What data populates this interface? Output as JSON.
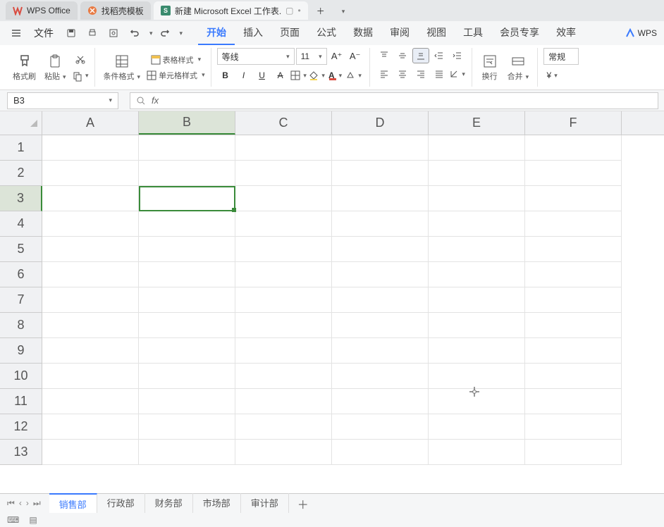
{
  "title_tabs": [
    {
      "icon": "wps",
      "label": "WPS Office"
    },
    {
      "icon": "template",
      "label": "找稻壳模板"
    },
    {
      "icon": "excel",
      "label": "新建 Microsoft Excel 工作表.",
      "active": true
    }
  ],
  "file_menu": "文件",
  "menu": {
    "items": [
      "开始",
      "插入",
      "页面",
      "公式",
      "数据",
      "审阅",
      "视图",
      "工具",
      "会员专享",
      "效率"
    ],
    "active": "开始",
    "ai": "WPS"
  },
  "ribbon": {
    "format_brush": "格式刷",
    "paste": "粘贴",
    "cond_format": "条件格式",
    "table_style": "表格样式",
    "cell_style": "单元格样式",
    "font_name": "等线",
    "font_size": "11",
    "wrap": "换行",
    "merge": "合并",
    "general": "常规",
    "currency": "¥"
  },
  "name_box": "B3",
  "columns": [
    "A",
    "B",
    "C",
    "D",
    "E",
    "F"
  ],
  "rows": [
    "1",
    "2",
    "3",
    "4",
    "5",
    "6",
    "7",
    "8",
    "9",
    "10",
    "11",
    "12",
    "13"
  ],
  "selected_col": "B",
  "selected_row": "3",
  "sheets": [
    "销售部",
    "行政部",
    "财务部",
    "市场部",
    "审计部"
  ],
  "active_sheet": "销售部"
}
